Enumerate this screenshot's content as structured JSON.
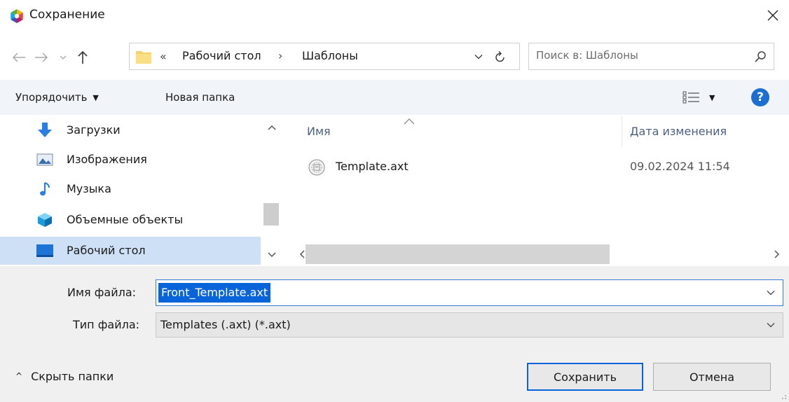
{
  "window": {
    "title": "Сохранение",
    "icons": {
      "app": "app-logo-icon",
      "close": "close-icon"
    }
  },
  "navigation": {
    "icons": {
      "back": "arrow-left-icon",
      "forward": "arrow-right-icon",
      "recent": "chevron-down-icon",
      "up": "arrow-up-icon"
    }
  },
  "address": {
    "overflow": "«",
    "crumbs": [
      "Рабочий стол",
      "Шаблоны"
    ],
    "separator": "›",
    "icons": {
      "folder": "folder-icon",
      "dropdown": "chevron-down-icon",
      "refresh": "refresh-icon"
    }
  },
  "search": {
    "placeholder": "Поиск в: Шаблоны",
    "icon": "search-icon"
  },
  "toolbar": {
    "organize": "Упорядочить",
    "new_folder": "Новая папка",
    "help": "?",
    "icons": {
      "view": "view-options-icon",
      "help": "help-icon"
    }
  },
  "nav_pane": {
    "items": [
      {
        "label": "Загрузки",
        "icon": "downloads-icon",
        "selected": false
      },
      {
        "label": "Изображения",
        "icon": "pictures-icon",
        "selected": false
      },
      {
        "label": "Музыка",
        "icon": "music-icon",
        "selected": false
      },
      {
        "label": "Объемные объекты",
        "icon": "3d-objects-icon",
        "selected": false
      },
      {
        "label": "Рабочий стол",
        "icon": "desktop-icon",
        "selected": true
      }
    ]
  },
  "file_list": {
    "columns": [
      "Имя",
      "Дата изменения"
    ],
    "files": [
      {
        "name": "Template.axt",
        "date": "09.02.2024 11:54",
        "icon": "file-axt-icon"
      }
    ]
  },
  "form": {
    "filename_label": "Имя файла:",
    "filename_value": "Front_Template.axt",
    "filetype_label": "Тип файла:",
    "filetype_value": "Templates (.axt) (*.axt)"
  },
  "footer": {
    "hide_folders": "Скрыть папки",
    "save": "Сохранить",
    "cancel": "Отмена"
  },
  "colors": {
    "accent": "#0a64d9",
    "toolbar_bg": "#f1f4f9",
    "selection": "#cde0f5",
    "bottom_bg": "#f0f0f0"
  }
}
